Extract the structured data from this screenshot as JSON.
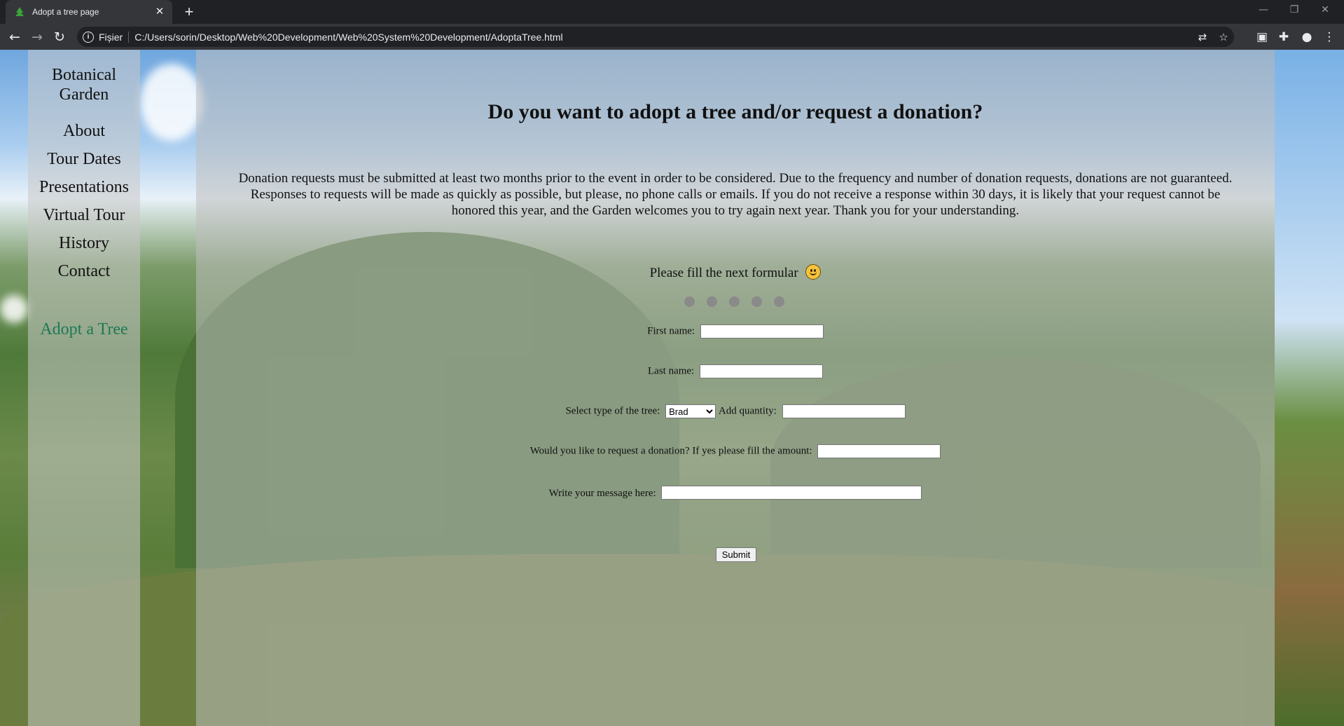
{
  "browser": {
    "tab_title": "Adopt a tree page",
    "new_tab_label": "+",
    "scheme_label": "Fișier",
    "url": "C:/Users/sorin/Desktop/Web%20Development/Web%20System%20Development/AdoptaTree.html"
  },
  "nav": {
    "brand": "Botanical Garden",
    "items": [
      "About",
      "Tour Dates",
      "Presentations",
      "Virtual Tour",
      "History",
      "Contact"
    ],
    "active_item": "Adopt a Tree",
    "active_color": "#1e7a55"
  },
  "main": {
    "heading": "Do you want to adopt a tree and/or request a donation?",
    "paragraph": "Donation requests must be submitted at least two months prior to the event in order to be considered. Due to the frequency and number of donation requests, donations are not guaranteed. Responses to requests will be made as quickly as possible, but please, no phone calls or emails. If you do not receive a response within 30 days, it is likely that your request cannot be honored this year, and the Garden welcomes you to try again next year. Thank you for your understanding.",
    "fill_prompt": "Please fill the next formular"
  },
  "form": {
    "first_name_label": "First name:",
    "first_name_value": "",
    "last_name_label": "Last name:",
    "last_name_value": "",
    "tree_type_label": "Select type of the tree:",
    "tree_type_selected": "Brad",
    "quantity_label": "Add quantity:",
    "quantity_value": "",
    "donation_label": "Would you like to request a donation? If yes please fill the amount:",
    "donation_value": "",
    "message_label": "Write your message here:",
    "message_value": "",
    "submit_label": "Submit"
  }
}
